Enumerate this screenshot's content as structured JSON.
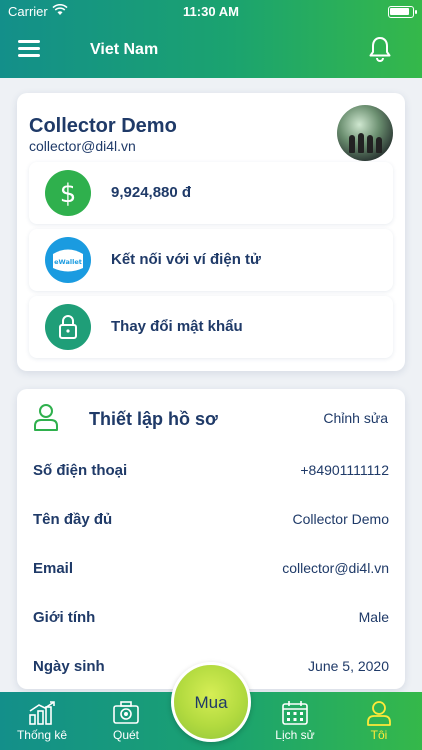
{
  "status_bar": {
    "carrier": "Carrier",
    "time": "11:30 AM"
  },
  "header": {
    "title": "Viet Nam",
    "menu_icon": "hamburger-menu-icon",
    "bell_icon": "bell-icon"
  },
  "profile": {
    "name": "Collector Demo",
    "email": "collector@di4l.vn",
    "actions": [
      {
        "icon": "dollar-icon",
        "label": "9,924,880 đ",
        "color": "#2fb04d"
      },
      {
        "icon": "ewallet-icon",
        "label": "Kết nối với ví điện tử",
        "icon_text": "eWallet",
        "color": "#1a9be0"
      },
      {
        "icon": "lock-icon",
        "label": "Thay đổi mật khẩu",
        "color": "#1f9e78"
      }
    ]
  },
  "settings": {
    "title": "Thiết lập hồ sơ",
    "edit_label": "Chỉnh sửa",
    "fields": [
      {
        "key": "Số điện thoại",
        "value": "+84901111112"
      },
      {
        "key": "Tên đầy đủ",
        "value": "Collector Demo"
      },
      {
        "key": "Email",
        "value": "collector@di4l.vn"
      },
      {
        "key": "Giới tính",
        "value": "Male"
      },
      {
        "key": "Ngày sinh",
        "value": "June 5, 2020"
      }
    ]
  },
  "tabbar": {
    "tabs": [
      {
        "label": "Thống kê",
        "icon": "chart-icon"
      },
      {
        "label": "Quét",
        "icon": "camera-icon"
      },
      {
        "label": "Lịch sử",
        "icon": "calendar-icon"
      },
      {
        "label": "Tôi",
        "icon": "user-icon",
        "active": true
      }
    ],
    "center_button": "Mua",
    "active_color": "#ffe93a"
  },
  "colors": {
    "brand_start": "#138f8a",
    "brand_end": "#35b84a",
    "text": "#1f3a68"
  }
}
